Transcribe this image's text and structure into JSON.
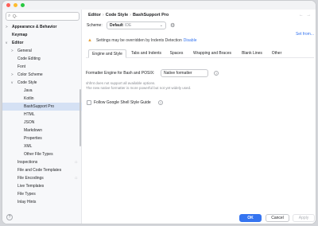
{
  "search": {
    "placeholder": "Q-",
    "icon": "search-icon"
  },
  "sidebar": {
    "items": [
      {
        "label": "Appearance & Behavior",
        "arrow": ">",
        "bold": true
      },
      {
        "label": "Keymap",
        "arrow": "",
        "bold": true
      },
      {
        "label": "Editor",
        "arrow": "v",
        "bold": true
      },
      {
        "label": "General",
        "arrow": ">"
      },
      {
        "label": "Code Editing",
        "arrow": ""
      },
      {
        "label": "Font",
        "arrow": ""
      },
      {
        "label": "Color Scheme",
        "arrow": ">"
      },
      {
        "label": "Code Style",
        "arrow": "v"
      },
      {
        "label": "Java",
        "arrow": ""
      },
      {
        "label": "Kotlin",
        "arrow": ""
      },
      {
        "label": "BashSupport Pro",
        "arrow": "",
        "selected": true
      },
      {
        "label": "HTML",
        "arrow": ""
      },
      {
        "label": "JSON",
        "arrow": ""
      },
      {
        "label": "Markdown",
        "arrow": ""
      },
      {
        "label": "Properties",
        "arrow": ""
      },
      {
        "label": "XML",
        "arrow": ""
      },
      {
        "label": "Other File Types",
        "arrow": ""
      },
      {
        "label": "Inspections",
        "arrow": "",
        "badge": "□"
      },
      {
        "label": "File and Code Templates",
        "arrow": ""
      },
      {
        "label": "File Encodings",
        "arrow": "",
        "badge": "□"
      },
      {
        "label": "Live Templates",
        "arrow": ""
      },
      {
        "label": "File Types",
        "arrow": ""
      },
      {
        "label": "Inlay Hints",
        "arrow": ""
      }
    ],
    "help": "?"
  },
  "breadcrumb": [
    "Editor",
    "Code Style",
    "BashSupport Pro"
  ],
  "nav": {
    "back": "←",
    "forward": "→"
  },
  "scheme": {
    "label": "Scheme:",
    "name": "Default",
    "sub": "IDE",
    "chevron": "⌄",
    "gear_icon": "gear-icon"
  },
  "set_from": "Set from...",
  "warning": {
    "text": "Settings may be overridden by Indents Detection",
    "link": "Disable",
    "icon": "warning-icon"
  },
  "tabs": [
    "Engine and Style",
    "Tabs and Indents",
    "Spaces",
    "Wrapping and Braces",
    "Blank Lines",
    "Other"
  ],
  "formatter": {
    "label": "Formatter Engine for Bash and POSIX:",
    "value": "Native formatter",
    "desc1": "shfmt does not support all available options.",
    "desc2": "The new native formatter is more powerful but not yet widely used."
  },
  "google_style": {
    "label": "Follow Google Shell Style Guide",
    "checked": false
  },
  "buttons": {
    "ok": "OK",
    "cancel": "Cancel",
    "apply": "Apply"
  },
  "colors": {
    "accent": "#3574f0",
    "selection": "#d5e1f4",
    "warning": "#e8a33c"
  }
}
